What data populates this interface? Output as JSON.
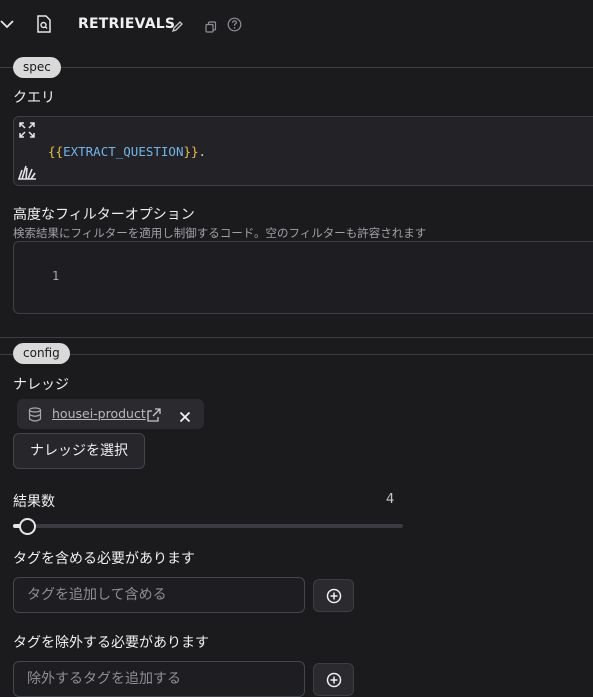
{
  "header": {
    "title": "RETRIEVALS",
    "icons": [
      "chevron-down-icon",
      "file-search-icon",
      "pencil-icon",
      "copy-icon",
      "help-icon"
    ]
  },
  "spec": {
    "section_label": "spec",
    "query_label": "クエリ",
    "query_code": {
      "open_brace": "{{",
      "variable": "EXTRACT_QUESTION",
      "close_brace": "}}",
      "tail": "."
    },
    "filter_label": "高度なフィルターオプション",
    "filter_description": "検索結果にフィルターを適用し制御するコード。空のフィルターも許容されます",
    "filter_line_number": "1"
  },
  "config": {
    "section_label": "config",
    "knowledge_label": "ナレッジ",
    "knowledge_chip": "housei-product",
    "select_knowledge_button": "ナレッジを選択",
    "results_label": "結果数",
    "results_value": "4",
    "slider_fraction": 0.0,
    "include_tags_label": "タグを含める必要があります",
    "include_tags_placeholder": "タグを追加して含める",
    "exclude_tags_label": "タグを除外する必要があります",
    "exclude_tags_placeholder": "除外するタグを追加する"
  }
}
